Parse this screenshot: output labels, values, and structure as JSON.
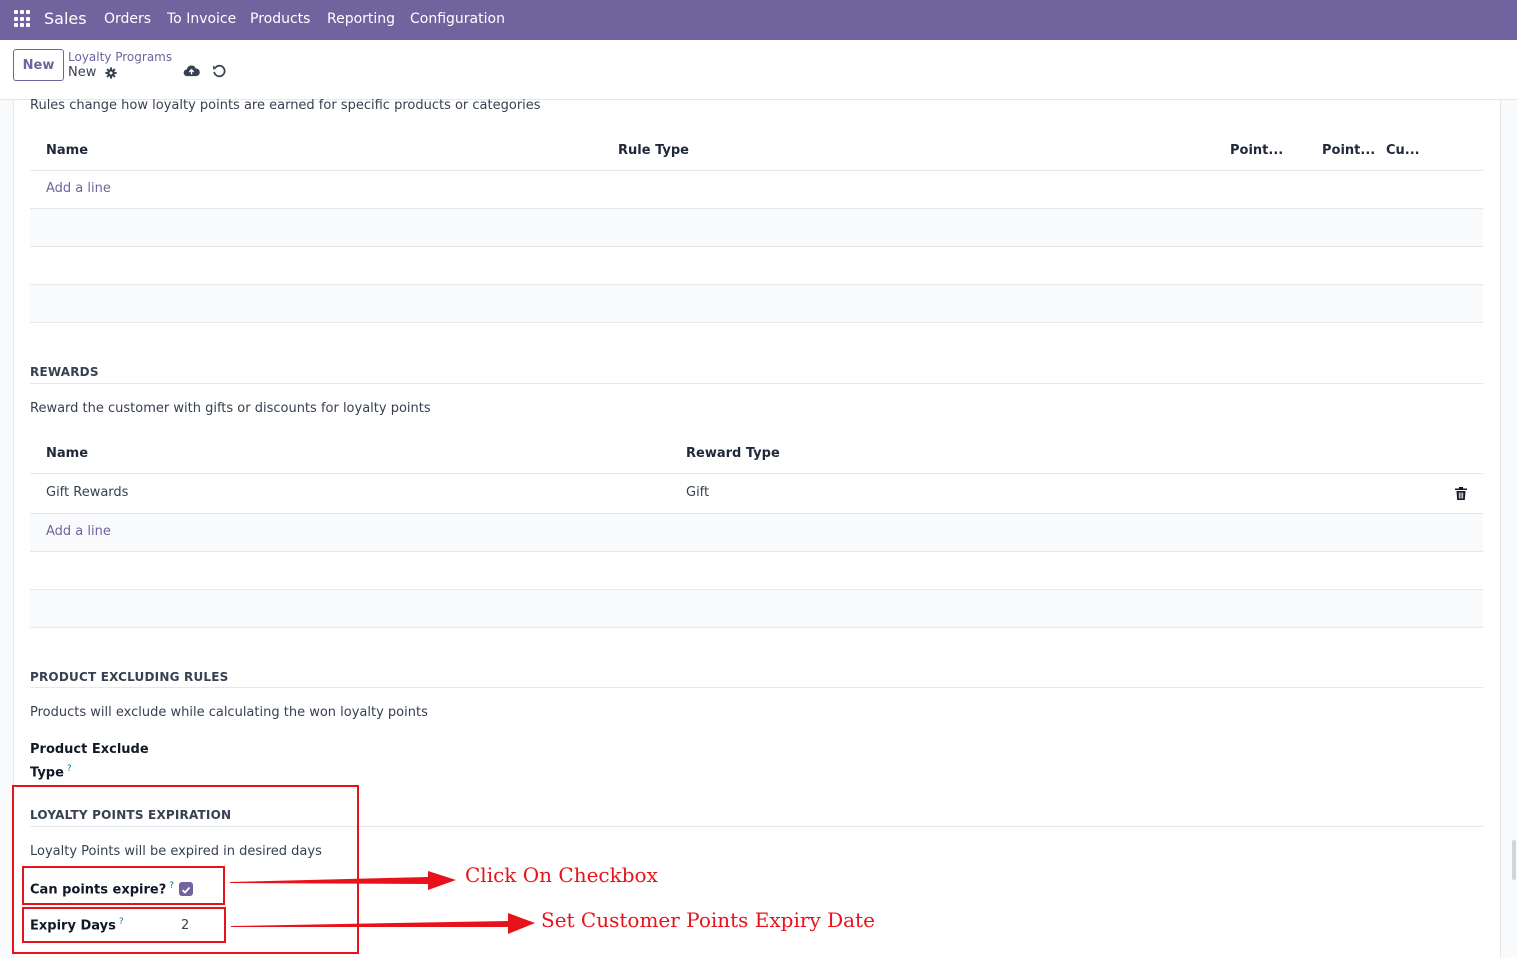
{
  "navbar": {
    "app_name": "Sales",
    "menu": [
      "Orders",
      "To Invoice",
      "Products",
      "Reporting",
      "Configuration"
    ]
  },
  "control_panel": {
    "new_button": "New",
    "breadcrumb_parent": "Loyalty Programs",
    "breadcrumb_current": "New"
  },
  "rules": {
    "description": "Rules change how loyalty points are earned for specific products or categories",
    "columns": [
      "Name",
      "Rule Type",
      "Point...",
      "Point...",
      "Cu..."
    ],
    "add_line": "Add a line"
  },
  "rewards": {
    "title": "REWARDS",
    "description": "Reward the customer with gifts or discounts for loyalty points",
    "columns": [
      "Name",
      "Reward Type"
    ],
    "rows": [
      {
        "name": "Gift Rewards",
        "reward_type": "Gift"
      }
    ],
    "add_line": "Add a line"
  },
  "product_excluding": {
    "title": "PRODUCT EXCLUDING RULES",
    "description": "Products will exclude while calculating the won loyalty points",
    "field_label_line1": "Product Exclude",
    "field_label_line2": "Type",
    "tooltip_mark": "?"
  },
  "expiration": {
    "title": "LOYALTY POINTS EXPIRATION",
    "description": "Loyalty Points will be expired in desired days",
    "can_expire_label": "Can points expire?",
    "can_expire_checked": true,
    "expiry_days_label": "Expiry Days",
    "expiry_days_value": "2",
    "tooltip_mark": "?"
  },
  "annotations": {
    "checkbox_note": "Click On Checkbox",
    "expiry_note": "Set Customer Points Expiry Date",
    "color": "#e8121b"
  },
  "colors": {
    "brand": "#71639e",
    "tooltip": "#017e84"
  }
}
